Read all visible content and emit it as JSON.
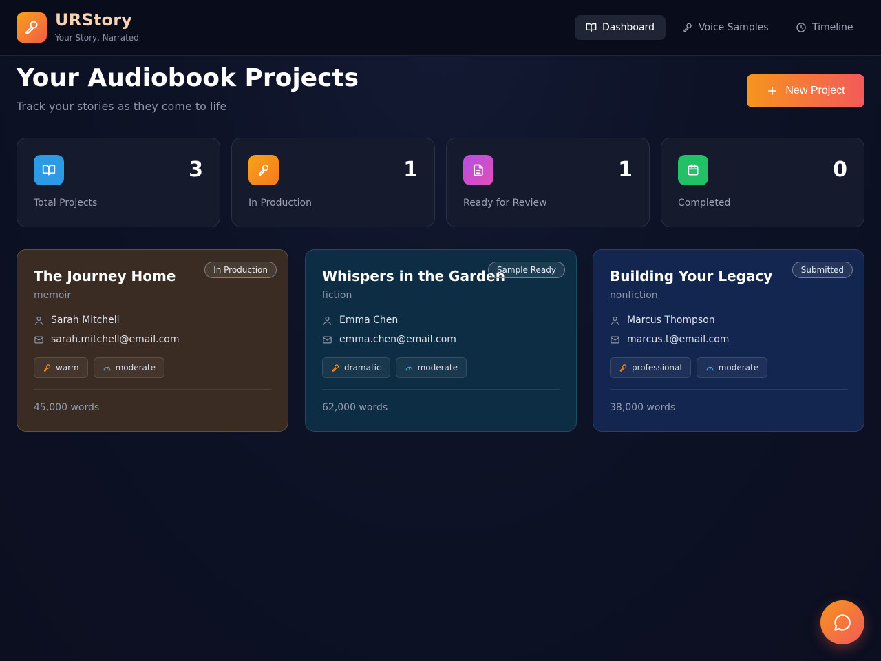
{
  "brand": {
    "title": "URStory",
    "subtitle": "Your Story, Narrated"
  },
  "nav": [
    {
      "label": "Dashboard",
      "icon": "book-open-icon",
      "active": true
    },
    {
      "label": "Voice Samples",
      "icon": "microphone-icon",
      "active": false
    },
    {
      "label": "Timeline",
      "icon": "clock-icon",
      "active": false
    }
  ],
  "page": {
    "title": "Your Audiobook Projects",
    "subtitle": "Track your stories as they come to life",
    "new_project_label": "New Project"
  },
  "stats": [
    {
      "value": "3",
      "label": "Total Projects",
      "icon": "book-open-icon",
      "color": "#2d9be3"
    },
    {
      "value": "1",
      "label": "In Production",
      "icon": "microphone-icon",
      "color": "#f7941d"
    },
    {
      "value": "1",
      "label": "Ready for Review",
      "icon": "document-icon",
      "color": "#c94ad6"
    },
    {
      "value": "0",
      "label": "Completed",
      "icon": "calendar-icon",
      "color": "#22c067"
    }
  ],
  "projects": [
    {
      "title": "The Journey Home",
      "genre": "memoir",
      "status": "In Production",
      "author": "Sarah Mitchell",
      "email": "sarah.mitchell@email.com",
      "tone": "warm",
      "pace": "moderate",
      "words": "45,000 words"
    },
    {
      "title": "Whispers in the Garden",
      "genre": "fiction",
      "status": "Sample Ready",
      "author": "Emma Chen",
      "email": "emma.chen@email.com",
      "tone": "dramatic",
      "pace": "moderate",
      "words": "62,000 words"
    },
    {
      "title": "Building Your Legacy",
      "genre": "nonfiction",
      "status": "Submitted",
      "author": "Marcus Thompson",
      "email": "marcus.t@email.com",
      "tone": "professional",
      "pace": "moderate",
      "words": "38,000 words"
    }
  ],
  "colors": {
    "accent_orange": "#f7941d",
    "accent_red": "#f25a5a",
    "pace_blue": "#3aa7e8"
  }
}
